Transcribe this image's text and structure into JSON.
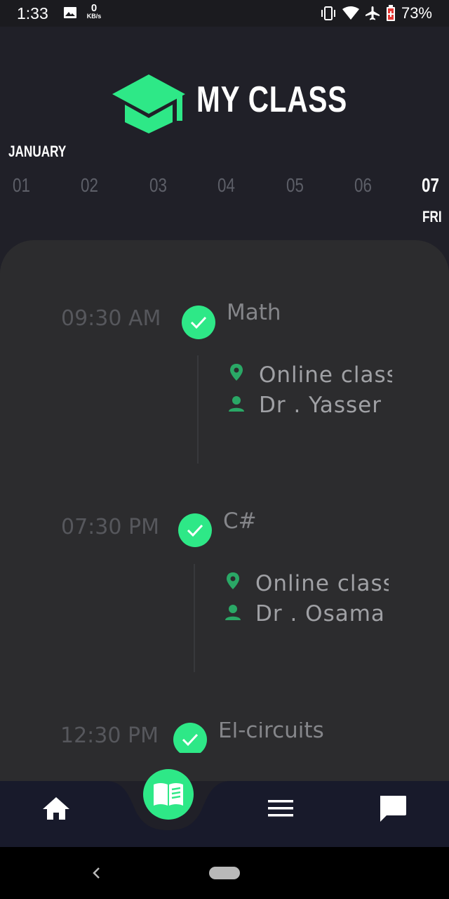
{
  "status_bar": {
    "time": "1:33",
    "network_speed_value": "0",
    "network_speed_unit": "KB/s",
    "battery_percent": "73%",
    "icons": [
      "image-icon",
      "vibrate-icon",
      "wifi-icon",
      "airplane-mode-icon",
      "battery-saver-icon"
    ]
  },
  "header": {
    "title": "MY CLASS",
    "logo_icon": "graduation-cap-icon",
    "accent_color": "#2ee887"
  },
  "calendar": {
    "month": "JANUARY",
    "days": [
      "01",
      "02",
      "03",
      "04",
      "05",
      "06",
      "07"
    ],
    "selected_day": "07",
    "selected_weekday": "FRI"
  },
  "schedule": [
    {
      "time": "09:30 AM",
      "subject": "Math",
      "location": "Online class",
      "instructor": "Dr . Yasser",
      "status": "done"
    },
    {
      "time": "07:30 PM",
      "subject": "C#",
      "location": "Online class",
      "instructor": "Dr . Osama",
      "status": "done"
    },
    {
      "time": "12:30 PM",
      "subject": "El-circuits",
      "location": "",
      "instructor": "",
      "status": "done"
    }
  ],
  "bottom_nav": {
    "items": [
      "home-icon",
      "book-icon",
      "menu-icon",
      "chat-icon"
    ],
    "active": "book-icon"
  },
  "system_nav": {
    "items": [
      "back-icon",
      "home-pill"
    ]
  }
}
